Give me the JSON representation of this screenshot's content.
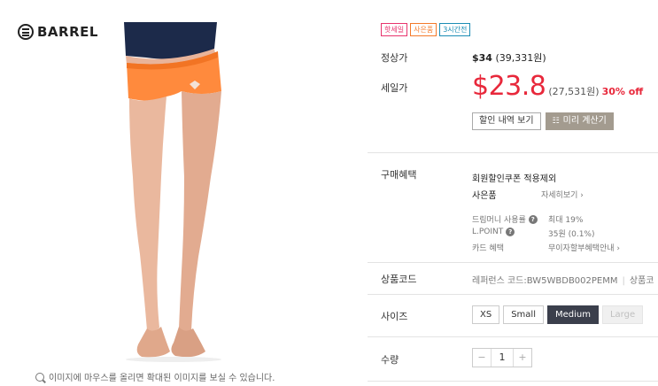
{
  "brand": {
    "name": "BARREL"
  },
  "image": {
    "zoom_hint": "이미지에 마우스를 올리면 확대된 이미지를 보실 수 있습니다."
  },
  "badges": [
    "핫세일",
    "사은품",
    "3시간전"
  ],
  "price": {
    "regular_label": "정상가",
    "regular_usd": "$34",
    "regular_krw": "(39,331원)",
    "sale_label": "세일가",
    "sale_usd": "$23.8",
    "sale_krw": "(27,531원)",
    "discount": "30% off"
  },
  "buttons": {
    "discount_history": "할인 내역 보기",
    "pre_calc": "미리 계산기"
  },
  "benefits": {
    "label": "구매혜택",
    "member_coupon": "회원할인쿠폰 적용제외",
    "gift": "사은품",
    "gift_more": "자세히보기 ›",
    "dream_money_label": "드림머니 사용률",
    "dream_money_value": "최대 19%",
    "lpoint_label": "L.POINT",
    "lpoint_value": "35원 (0.1%)",
    "card_label": "카드 혜택",
    "card_value": "무이자할부혜택안내 ›"
  },
  "product_code": {
    "label": "상품코드",
    "reference": "레퍼런스 코드:BW5WBDB002PEMM",
    "extra": "상품코"
  },
  "size": {
    "label": "사이즈",
    "options": [
      "XS",
      "Small",
      "Medium",
      "Large"
    ],
    "selected": "Medium",
    "unavailable": "Large"
  },
  "quantity": {
    "label": "수량",
    "value": "1",
    "minus": "−",
    "plus": "+"
  },
  "colors": {
    "sale_red": "#e8283b",
    "selected_size": "#3b3f4c",
    "shorts_orange": "#ff8a3d"
  }
}
